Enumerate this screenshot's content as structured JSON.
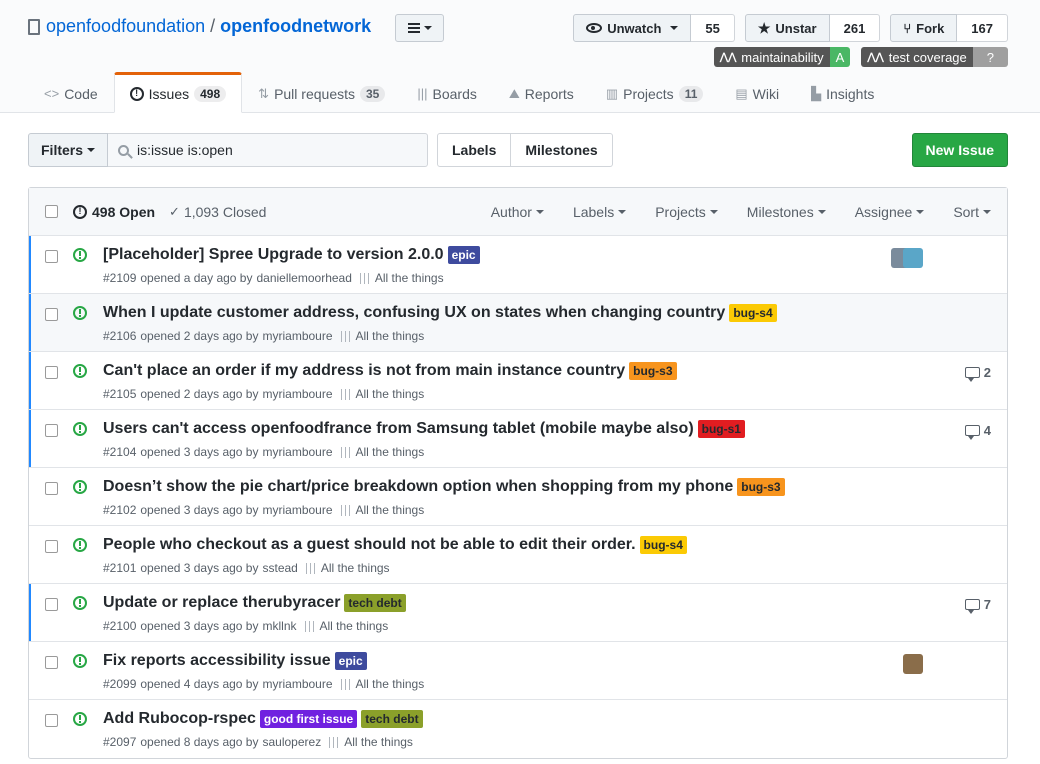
{
  "repo": {
    "owner": "openfoodfoundation",
    "separator": "/",
    "name": "openfoodnetwork"
  },
  "actions": {
    "watch": {
      "label": "Unwatch",
      "count": "55"
    },
    "star": {
      "label": "Unstar",
      "count": "261"
    },
    "fork": {
      "label": "Fork",
      "count": "167"
    }
  },
  "badges": [
    {
      "left": "maintainability",
      "right": "A",
      "color": "#4ab765"
    },
    {
      "left": "test coverage",
      "right": "?",
      "color": "#9f9f9f"
    }
  ],
  "tabs": [
    {
      "label": "Code",
      "icon": "code-icon"
    },
    {
      "label": "Issues",
      "count": "498",
      "icon": "issue-opened-icon"
    },
    {
      "label": "Pull requests",
      "count": "35",
      "icon": "git-pull-request-icon"
    },
    {
      "label": "Boards",
      "icon": "boards-icon"
    },
    {
      "label": "Reports",
      "icon": "graph-icon"
    },
    {
      "label": "Projects",
      "count": "11",
      "icon": "project-icon"
    },
    {
      "label": "Wiki",
      "icon": "book-icon"
    },
    {
      "label": "Insights",
      "icon": "insights-icon"
    }
  ],
  "subnav": {
    "filters_label": "Filters",
    "search_value": "is:issue is:open",
    "labels_label": "Labels",
    "milestones_label": "Milestones",
    "new_issue_label": "New Issue"
  },
  "list_header": {
    "open": "498 Open",
    "closed": "1,093 Closed",
    "filters": [
      "Author",
      "Labels",
      "Projects",
      "Milestones",
      "Assignee",
      "Sort"
    ]
  },
  "issues": [
    {
      "title": "[Placeholder] Spree Upgrade to version 2.0.0",
      "labels": [
        {
          "text": "epic",
          "bg": "#3e4b9e",
          "fg": "#ffffff"
        }
      ],
      "number": "#2109",
      "opened": "opened a day ago by",
      "author": "daniellemoorhead",
      "milestone": "All the things",
      "comments": "",
      "avatars": 2,
      "unread": true,
      "hl": false
    },
    {
      "title": "When I update customer address, confusing UX on states when changing country",
      "labels": [
        {
          "text": "bug-s4",
          "bg": "#fbca04",
          "fg": "#24292e"
        }
      ],
      "number": "#2106",
      "opened": "opened 2 days ago by",
      "author": "myriamboure",
      "milestone": "All the things",
      "comments": "",
      "avatars": 0,
      "unread": true,
      "hl": true
    },
    {
      "title": "Can't place an order if my address is not from main instance country",
      "labels": [
        {
          "text": "bug-s3",
          "bg": "#f7941d",
          "fg": "#24292e"
        }
      ],
      "number": "#2105",
      "opened": "opened 2 days ago by",
      "author": "myriamboure",
      "milestone": "All the things",
      "comments": "2",
      "avatars": 0,
      "unread": true,
      "hl": false
    },
    {
      "title": "Users can't access openfoodfrance from Samsung tablet (mobile maybe also)",
      "labels": [
        {
          "text": "bug-s1",
          "bg": "#e11d21",
          "fg": "#24292e"
        }
      ],
      "number": "#2104",
      "opened": "opened 3 days ago by",
      "author": "myriamboure",
      "milestone": "All the things",
      "comments": "4",
      "avatars": 0,
      "unread": true,
      "hl": false
    },
    {
      "title": "Doesn’t show the pie chart/price breakdown option when shopping from my phone",
      "labels": [
        {
          "text": "bug-s3",
          "bg": "#f7941d",
          "fg": "#24292e"
        }
      ],
      "number": "#2102",
      "opened": "opened 3 days ago by",
      "author": "myriamboure",
      "milestone": "All the things",
      "comments": "",
      "avatars": 0,
      "unread": false,
      "hl": false
    },
    {
      "title": "People who checkout as a guest should not be able to edit their order.",
      "labels": [
        {
          "text": "bug-s4",
          "bg": "#fbca04",
          "fg": "#24292e"
        }
      ],
      "number": "#2101",
      "opened": "opened 3 days ago by",
      "author": "sstead",
      "milestone": "All the things",
      "comments": "",
      "avatars": 0,
      "unread": false,
      "hl": false
    },
    {
      "title": "Update or replace therubyracer",
      "labels": [
        {
          "text": "tech debt",
          "bg": "#8ba02a",
          "fg": "#24292e"
        }
      ],
      "number": "#2100",
      "opened": "opened 3 days ago by",
      "author": "mkllnk",
      "milestone": "All the things",
      "comments": "7",
      "avatars": 0,
      "unread": true,
      "hl": false
    },
    {
      "title": "Fix reports accessibility issue",
      "labels": [
        {
          "text": "epic",
          "bg": "#3e4b9e",
          "fg": "#ffffff"
        }
      ],
      "number": "#2099",
      "opened": "opened 4 days ago by",
      "author": "myriamboure",
      "milestone": "All the things",
      "comments": "",
      "avatars": 1,
      "unread": false,
      "hl": false
    },
    {
      "title": "Add Rubocop-rspec",
      "labels": [
        {
          "text": "good first issue",
          "bg": "#7021e0",
          "fg": "#ffffff"
        },
        {
          "text": "tech debt",
          "bg": "#8ba02a",
          "fg": "#24292e"
        }
      ],
      "number": "#2097",
      "opened": "opened 8 days ago by",
      "author": "sauloperez",
      "milestone": "All the things",
      "comments": "",
      "avatars": 0,
      "unread": false,
      "hl": false
    }
  ]
}
